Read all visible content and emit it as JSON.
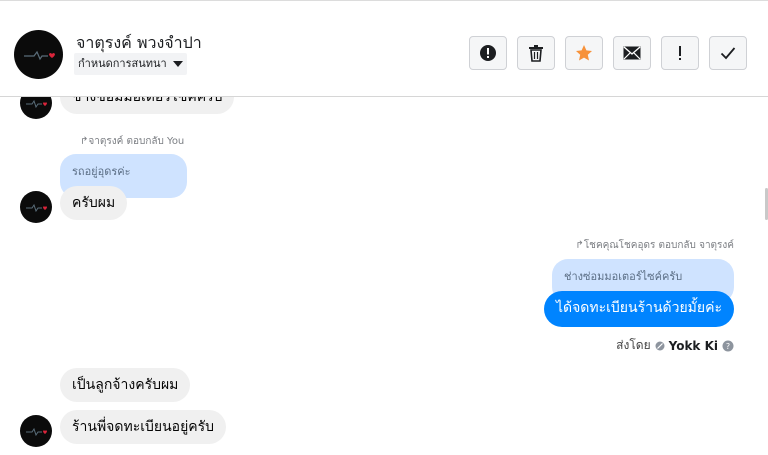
{
  "header": {
    "contact_name": "จาตุรงค์ พวงจำปา",
    "nickname_label": "กำหนดการสนทนา",
    "buttons": [
      "mark-spam",
      "delete",
      "star",
      "mail",
      "important",
      "done"
    ]
  },
  "messages": {
    "m1_text": "ช่างซ่อมมอเตอร์ไซค์ครับ",
    "reply1_label": "จาตุรงค์ ตอบกลับ You",
    "quote1_text": "รถอยู่อุดรค่ะ",
    "m2_text": "ครับผม",
    "reply2_label": "โชคคุณโชคอุดร ตอบกลับ จาตุรงค์",
    "quote2_text": "ช่างซ่อมมอเตอร์ไซค์ครับ",
    "m3_text": "ได้จดทะเบียนร้านด้วยมั้ยค่ะ",
    "sent_by_label": "ส่งโดย",
    "sent_by_name": "Yokk Ki",
    "m4_text": "เป็นลูกจ้างครับผม",
    "m5_text": "ร้านพี่จดทะเบียนอยู่ครับ"
  },
  "colors": {
    "outgoing_bubble": "#0084ff",
    "incoming_bubble": "#f0f0f0",
    "quote_bubble": "#cfe3ff",
    "star": "#f7923a"
  }
}
